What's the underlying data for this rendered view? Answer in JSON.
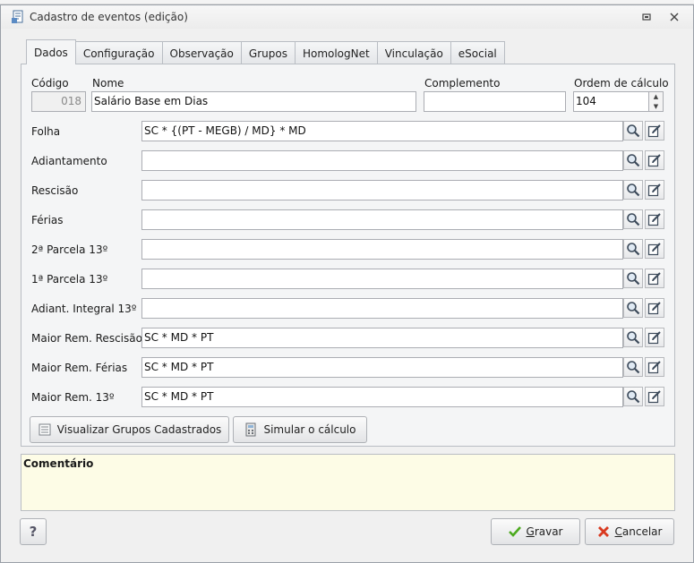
{
  "window": {
    "title": "Cadastro de eventos (edição)"
  },
  "tabs": [
    "Dados",
    "Configuração",
    "Observação",
    "Grupos",
    "HomologNet",
    "Vinculação",
    "eSocial"
  ],
  "header": {
    "codigo_label": "Código",
    "codigo_value": "018",
    "nome_label": "Nome",
    "nome_value": "Salário Base em Dias",
    "complemento_label": "Complemento",
    "complemento_value": "",
    "ordem_label": "Ordem de cálculo",
    "ordem_value": "104"
  },
  "formulas": [
    {
      "label": "Folha",
      "value": "SC * {(PT - MEGB) / MD} * MD"
    },
    {
      "label": "Adiantamento",
      "value": ""
    },
    {
      "label": "Rescisão",
      "value": ""
    },
    {
      "label": "Férias",
      "value": ""
    },
    {
      "label": "2ª Parcela 13º",
      "value": ""
    },
    {
      "label": "1ª Parcela 13º",
      "value": ""
    },
    {
      "label": "Adiant. Integral 13º",
      "value": ""
    },
    {
      "label": "Maior Rem. Rescisão",
      "value": "SC * MD * PT"
    },
    {
      "label": "Maior Rem. Férias",
      "value": "SC * MD * PT"
    },
    {
      "label": "Maior Rem. 13º",
      "value": "SC * MD * PT"
    }
  ],
  "buttons": {
    "visualizar": "Visualizar Grupos Cadastrados",
    "simular": "Simular o cálculo",
    "help": "?",
    "gravar_key": "G",
    "gravar_rest": "ravar",
    "cancelar_key": "C",
    "cancelar_rest": "ancelar"
  },
  "comment": {
    "label": "Comentário"
  }
}
